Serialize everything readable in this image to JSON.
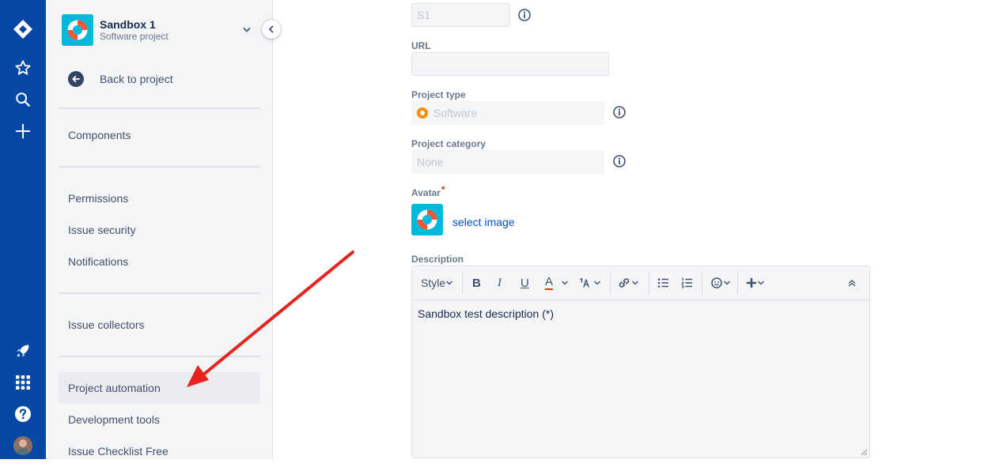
{
  "global_nav": {
    "icons": [
      "jira-logo-icon",
      "star-icon",
      "search-icon",
      "plus-icon",
      "rocket-icon",
      "app-switcher-icon",
      "help-icon",
      "user-avatar"
    ]
  },
  "sidebar": {
    "project_name": "Sandbox 1",
    "project_type": "Software project",
    "back_label": "Back to project",
    "items": [
      {
        "label": "Components"
      },
      {
        "label": "Permissions"
      },
      {
        "label": "Issue security"
      },
      {
        "label": "Notifications"
      },
      {
        "label": "Issue collectors"
      },
      {
        "label": "Project automation",
        "selected": true
      },
      {
        "label": "Development tools"
      },
      {
        "label": "Issue Checklist Free"
      }
    ]
  },
  "form": {
    "key_value": "S1",
    "url_label": "URL",
    "url_value": "",
    "project_type_label": "Project type",
    "project_type_value": "Software",
    "project_category_label": "Project category",
    "project_category_value": "None",
    "avatar_label": "Avatar",
    "required_mark": "*",
    "select_image": "select image",
    "description_label": "Description",
    "toolbar": {
      "style_label": "Style",
      "bold": "B",
      "italic": "I",
      "underline": "U",
      "text_color": "A"
    },
    "description_text": "Sandbox test description (*)"
  },
  "colors": {
    "global_nav": "#0747a6",
    "sidebar_bg": "#f4f5f7",
    "link": "#0052cc",
    "annotation_arrow": "#e8231e",
    "project_avatar": "#00b8d9",
    "software_icon": "#ff8b00"
  }
}
